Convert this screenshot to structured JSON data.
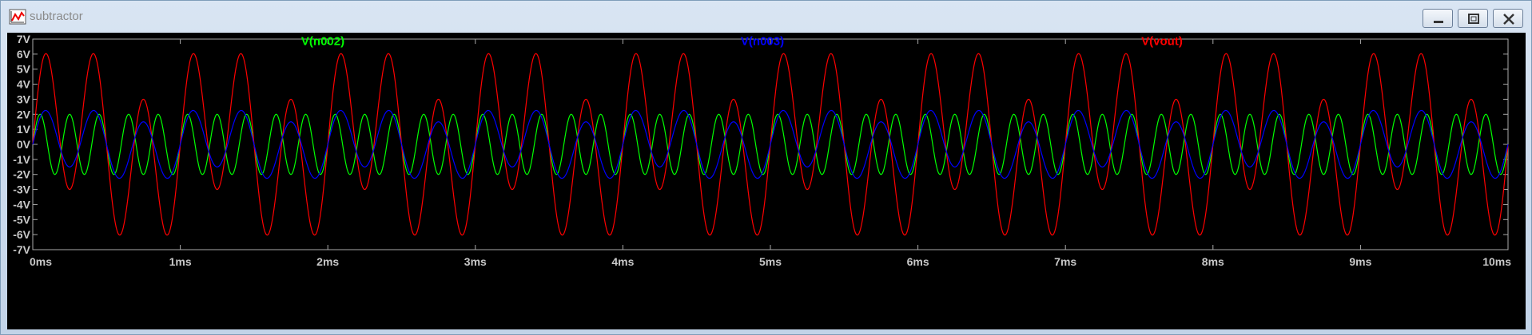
{
  "window": {
    "title": "subtractor",
    "icon": "waveform-chart-icon",
    "buttons": [
      "minimize-icon",
      "maximize-icon",
      "close-icon"
    ]
  },
  "chart_data": {
    "type": "line",
    "xlabel": "",
    "ylabel": "",
    "xlim": [
      0,
      10
    ],
    "ylim": [
      -7,
      7
    ],
    "grid": false,
    "x_ticks": [
      "0ms",
      "1ms",
      "2ms",
      "3ms",
      "4ms",
      "5ms",
      "6ms",
      "7ms",
      "8ms",
      "9ms",
      "10ms"
    ],
    "y_ticks": [
      "7V",
      "6V",
      "5V",
      "4V",
      "3V",
      "2V",
      "1V",
      "0V",
      "-1V",
      "-2V",
      "-3V",
      "-4V",
      "-5V",
      "-6V",
      "-7V"
    ],
    "legend_placement": "top",
    "series": [
      {
        "name": "V(n002)",
        "color": "#00ff00",
        "waveform": "sine",
        "amplitude_v": 2,
        "frequency_khz": 5,
        "phase_deg": 0
      },
      {
        "name": "V(n003)",
        "color": "#0000ff",
        "waveform": "two-tone",
        "components": [
          {
            "amplitude_v": 2,
            "frequency_khz": 3
          },
          {
            "amplitude_v": 0.5,
            "frequency_khz": 1
          }
        ]
      },
      {
        "name": "V(vout)",
        "color": "#ff0000",
        "waveform": "two-tone",
        "components": [
          {
            "amplitude_v": 5,
            "frequency_khz": 3
          },
          {
            "amplitude_v": 2,
            "frequency_khz": 1
          }
        ]
      }
    ]
  }
}
